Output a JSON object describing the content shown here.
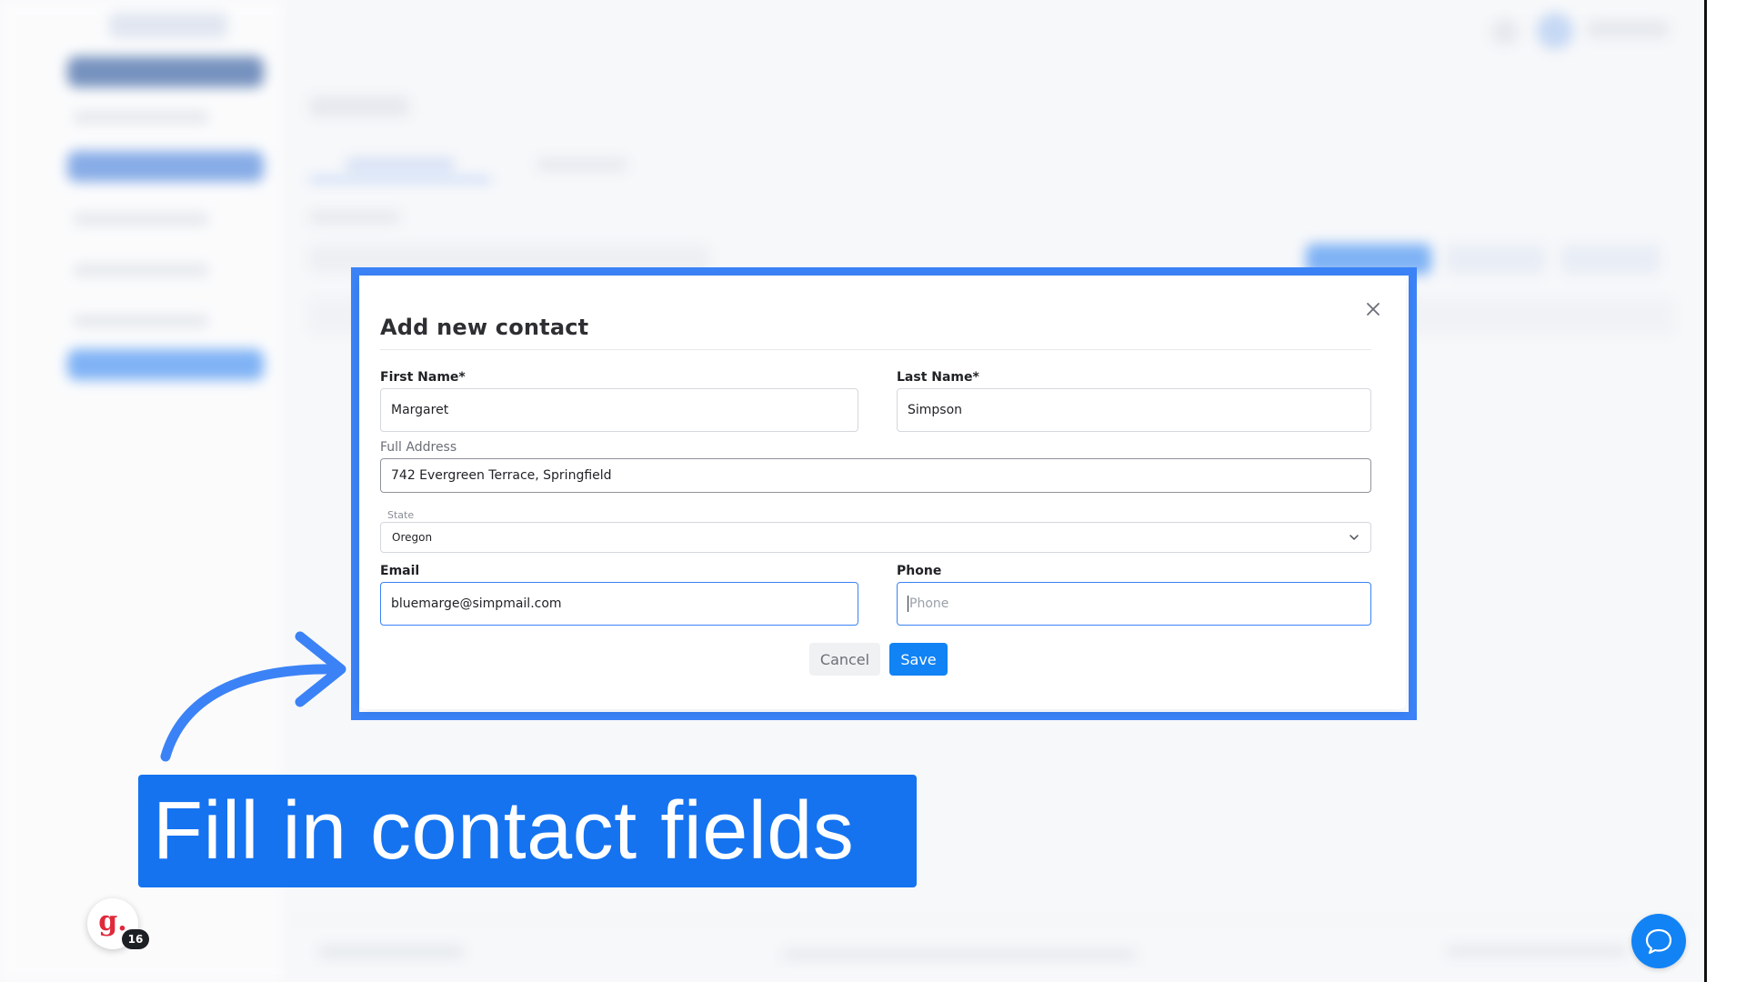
{
  "modal": {
    "title": "Add new contact",
    "first_name": {
      "label": "First Name*",
      "value": "Margaret"
    },
    "last_name": {
      "label": "Last Name*",
      "value": "Simpson"
    },
    "address": {
      "label": "Full Address",
      "value": "742 Evergreen Terrace, Springfield"
    },
    "state": {
      "label": "State",
      "value": "Oregon"
    },
    "email": {
      "label": "Email",
      "value": "bluemarge@simpmail.com"
    },
    "phone": {
      "label": "Phone",
      "placeholder": "Phone",
      "value": ""
    },
    "cancel_label": "Cancel",
    "save_label": "Save"
  },
  "annotation": {
    "caption": "Fill in contact fields",
    "frame_color": "#3b82f6",
    "banner_color": "#1573f0"
  },
  "widgets": {
    "g_letter": "g.",
    "g_badge_count": "16",
    "chat_icon": "chat-bubble-icon"
  },
  "colors": {
    "primary": "#1283f5",
    "focus_border": "#3b82f6"
  }
}
